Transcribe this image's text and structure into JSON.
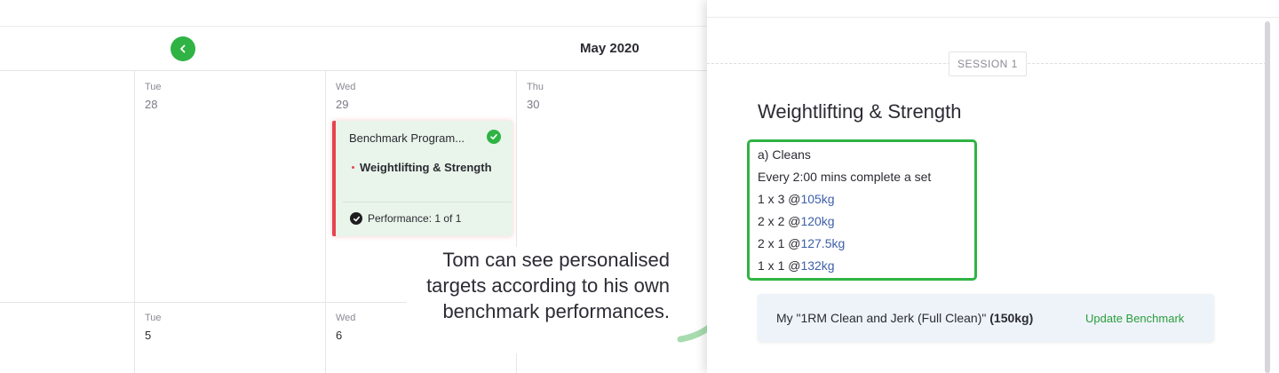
{
  "calendar": {
    "month_title": "May 2020",
    "prev_icon": "chevron-left-icon",
    "week1": [
      {
        "day": "Tue",
        "date": "28"
      },
      {
        "day": "Wed",
        "date": "29"
      },
      {
        "day": "Thu",
        "date": "30"
      }
    ],
    "week2": [
      {
        "day": "Tue",
        "date": "5"
      },
      {
        "day": "Wed",
        "date": "6"
      }
    ],
    "event": {
      "title": "Benchmark Program...",
      "workout": "Weightlifting & Strength",
      "performance": "Performance: 1 of 1",
      "accent_color": "#e8434d",
      "status_icon": "check-circle-icon"
    }
  },
  "annotation": {
    "text": "Tom can see personalised targets according to his own benchmark performances."
  },
  "panel": {
    "session_label": "SESSION 1",
    "workout_title": "Weightlifting & Strength",
    "targets": {
      "exercise": "a) Cleans",
      "instruction": "Every 2:00 mins complete a set",
      "sets": [
        {
          "prefix": "1 x 3 @",
          "weight": "105kg"
        },
        {
          "prefix": "2 x 2 @",
          "weight": "120kg"
        },
        {
          "prefix": "2 x 1 @",
          "weight": "127.5kg"
        },
        {
          "prefix": "1 x 1 @",
          "weight": "132kg"
        }
      ]
    },
    "benchmark": {
      "label": "My \"1RM Clean and Jerk (Full Clean)\"",
      "value": "(150kg)",
      "link": "Update Benchmark"
    }
  },
  "colors": {
    "accent_green": "#2fb344",
    "weight_blue": "#3d5fa8",
    "event_red": "#e8434d"
  }
}
